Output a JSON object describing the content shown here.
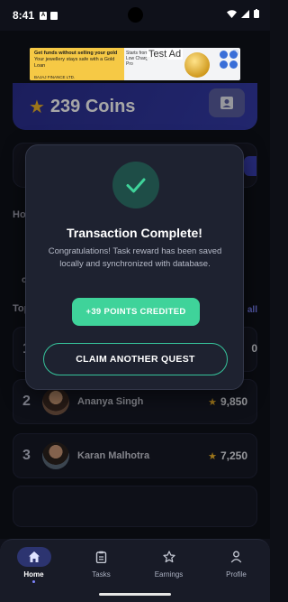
{
  "status_bar": {
    "time": "8:41",
    "icons_left": [
      "notification-a-icon",
      "sim-icon"
    ],
    "icons_right": [
      "wifi-icon",
      "signal-icon",
      "battery-icon"
    ]
  },
  "ad": {
    "label": "Test Ad",
    "headline": "Get funds without selling your gold",
    "subline": "Your jewellery stays safe with a Gold Loan",
    "center_text": "Starts from ₹9,000 Low Charges Instant Pro",
    "sponsor": "BAJAJ FINANCE LTD."
  },
  "coins": {
    "value": "239 Coins"
  },
  "partial_labels": {
    "section_home": "Ho",
    "section_top": "Top",
    "see_all": "all",
    "row_c": "c",
    "score_edge": "0"
  },
  "dialog": {
    "title": "Transaction Complete!",
    "message": "Congratulations! Task reward has been saved locally and synchronized with database.",
    "points_badge": "+39 POINTS CREDITED",
    "claim_button": "CLAIM ANOTHER QUEST"
  },
  "leaderboard": [
    {
      "rank": "2",
      "name": "Ananya Singh",
      "score": "9,850"
    },
    {
      "rank": "3",
      "name": "Karan Malhotra",
      "score": "7,250"
    }
  ],
  "nav": [
    {
      "label": "Home",
      "icon": "home-icon",
      "active": true
    },
    {
      "label": "Tasks",
      "icon": "clipboard-icon",
      "active": false
    },
    {
      "label": "Earnings",
      "icon": "star-outline-icon",
      "active": false
    },
    {
      "label": "Profile",
      "icon": "person-icon",
      "active": false
    }
  ],
  "colors": {
    "accent_green": "#3fd39a",
    "nav_active": "#2c3470",
    "star_gold": "#f0b429",
    "coin_card": "#2a2f8f"
  }
}
